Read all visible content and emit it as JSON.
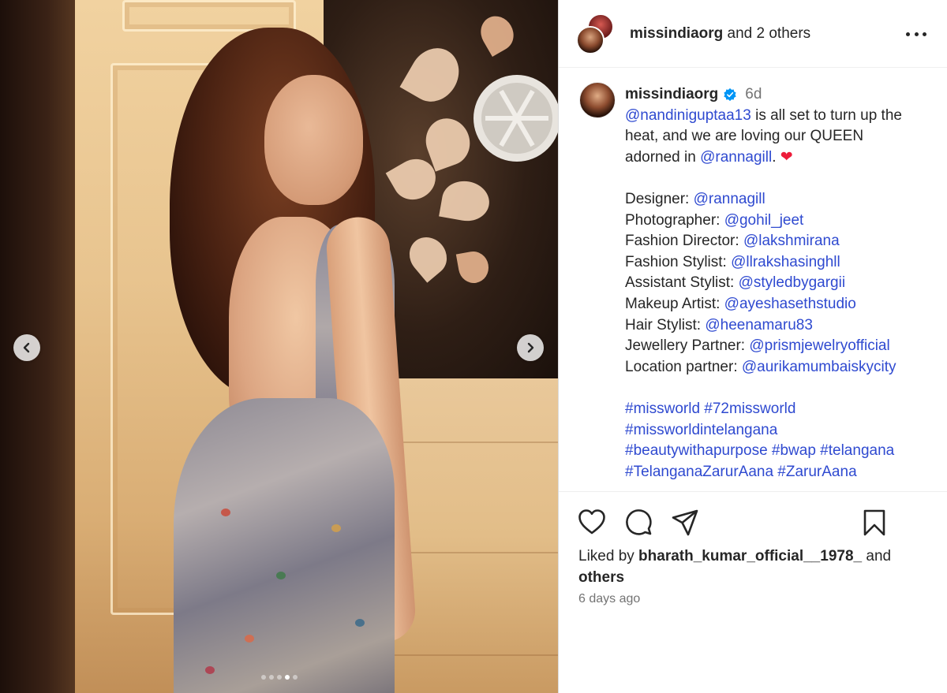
{
  "header": {
    "username": "missindiaorg",
    "suffix": "and 2 others",
    "more_icon": "more-horizontal-icon"
  },
  "post": {
    "username": "missindiaorg",
    "verified": true,
    "time": "6d",
    "caption": {
      "mention1": "@nandiniguptaa13",
      "line1_rest": " is all set to turn up the",
      "line2": "heat, and we are loving our QUEEN",
      "line3_pre": "adorned in ",
      "mention2": "@rannagill",
      "line3_post": ".",
      "emoji": "❤"
    },
    "credits": [
      {
        "label": "Designer: ",
        "handle": "@rannagill"
      },
      {
        "label": "Photographer: ",
        "handle": "@gohil_jeet"
      },
      {
        "label": "Fashion Director: ",
        "handle": "@lakshmirana"
      },
      {
        "label": "Fashion Stylist: ",
        "handle": "@llrakshasinghll"
      },
      {
        "label": "Assistant Stylist: ",
        "handle": "@styledbygargii"
      },
      {
        "label": "Makeup Artist: ",
        "handle": "@ayeshasethstudio"
      },
      {
        "label": "Hair Stylist: ",
        "handle": "@heenamaru83"
      },
      {
        "label": "Jewellery Partner: ",
        "handle": "@prismjewelryofficial"
      },
      {
        "label": "Location partner: ",
        "handle": "@aurikamumbaiskycity"
      }
    ],
    "hashtag_lines": [
      "#missworld #72missworld",
      "#missworldintelangana",
      "#beautywithapurpose #bwap #telangana",
      "#TelanganaZarurAana #ZarurAana"
    ]
  },
  "likes": {
    "prefix": "Liked by ",
    "user": "bharath_kumar_official__1978_",
    "middle": " and",
    "others": "others"
  },
  "posted_ago": "6 days ago",
  "carousel": {
    "total": 5,
    "active_index": 3
  },
  "colors": {
    "link": "#2f4ad0",
    "verified": "#0095f6",
    "heart": "#ed1c3a"
  }
}
